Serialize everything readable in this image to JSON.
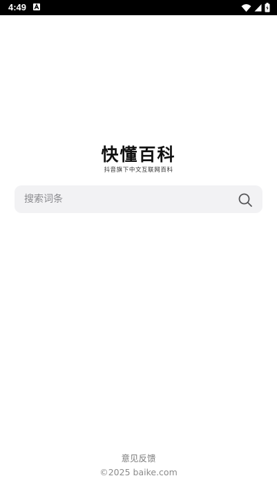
{
  "status_bar": {
    "time": "4:49",
    "icons": [
      "a-notification-icon",
      "wifi-icon",
      "signal-icon",
      "battery-icon"
    ]
  },
  "logo": {
    "title": "快懂百科",
    "subtitle": "抖音旗下中文互联网百科"
  },
  "search": {
    "placeholder": "搜索词条",
    "icon": "search-icon"
  },
  "footer": {
    "feedback": "意见反馈",
    "copyright": "©2025 baike.com"
  },
  "colors": {
    "status_bar_bg": "#000000",
    "search_bg": "#f2f2f4",
    "footer_text": "#808080"
  }
}
